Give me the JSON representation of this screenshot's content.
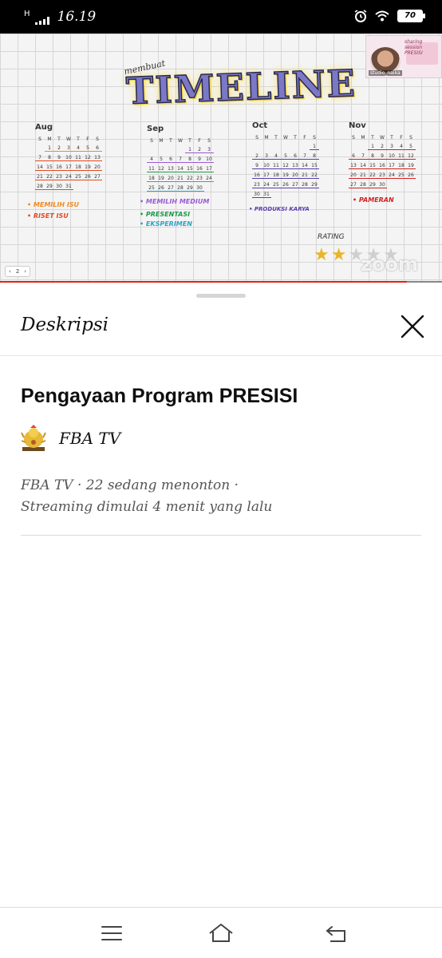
{
  "status_bar": {
    "network": "H",
    "time": "16.19",
    "battery": "70",
    "icons": [
      "alarm-icon",
      "wifi-icon",
      "battery-icon"
    ]
  },
  "video": {
    "whiteboard_subtitle": "membuat",
    "whiteboard_title": "TIMELINE",
    "calendars": [
      {
        "month": "Aug",
        "weekdays": [
          "S",
          "M",
          "T",
          "W",
          "T",
          "F",
          "S"
        ],
        "days": [
          "1",
          "2",
          "3",
          "4",
          "5",
          "6",
          "7",
          "8",
          "9",
          "10",
          "11",
          "12",
          "13",
          "14",
          "15",
          "16",
          "17",
          "18",
          "19",
          "20",
          "21",
          "22",
          "23",
          "24",
          "25",
          "26",
          "27",
          "28",
          "29",
          "30",
          "31"
        ]
      },
      {
        "month": "Sep",
        "weekdays": [
          "S",
          "M",
          "T",
          "W",
          "T",
          "F",
          "S"
        ],
        "days": [
          "1",
          "2",
          "3",
          "4",
          "5",
          "6",
          "7",
          "8",
          "9",
          "10",
          "11",
          "12",
          "13",
          "14",
          "15",
          "16",
          "17",
          "18",
          "19",
          "20",
          "21",
          "22",
          "23",
          "24",
          "25",
          "26",
          "27",
          "28",
          "29",
          "30"
        ]
      },
      {
        "month": "Oct",
        "weekdays": [
          "S",
          "M",
          "T",
          "W",
          "T",
          "F",
          "S"
        ],
        "days": [
          "1",
          "2",
          "3",
          "4",
          "5",
          "6",
          "7",
          "8",
          "9",
          "10",
          "11",
          "12",
          "13",
          "14",
          "15",
          "16",
          "17",
          "18",
          "19",
          "20",
          "21",
          "22",
          "23",
          "24",
          "25",
          "26",
          "27",
          "28",
          "29",
          "30",
          "31"
        ]
      },
      {
        "month": "Nov",
        "weekdays": [
          "S",
          "M",
          "T",
          "W",
          "T",
          "F",
          "S"
        ],
        "days": [
          "1",
          "2",
          "3",
          "4",
          "5",
          "6",
          "7",
          "8",
          "9",
          "10",
          "11",
          "12",
          "13",
          "14",
          "15",
          "16",
          "17",
          "18",
          "19",
          "20",
          "21",
          "22",
          "23",
          "24",
          "25",
          "26",
          "27",
          "28",
          "29",
          "30"
        ]
      }
    ],
    "notes": {
      "aug_1": "• MEMILIH ISU",
      "aug_2": "• RISET ISU",
      "sep_1": "• MEMILIH MEDIUM",
      "sep_2": "• PRESENTASI",
      "sep_3": "• EKSPERIMEN",
      "oct_1": "• PRODUKSI KARYA",
      "nov_1": "• PAMERAN"
    },
    "rating_label": "RATING",
    "rating_value": 2,
    "rating_max": 5,
    "watermark": "zoom",
    "participant": {
      "caption": "sharing session PRESISI",
      "name": "studio_naika"
    },
    "page_control": {
      "prev": "‹",
      "page": "2",
      "next": "›"
    },
    "progress": 0.92,
    "colors": {
      "progress": "#e62117",
      "title_fill": "#7b78c8",
      "highlight": "#f6dc5a"
    }
  },
  "sheet": {
    "title": "Deskripsi",
    "close_icon": "close-icon",
    "video_title": "Pengayaan Program PRESISI",
    "channel_name": "FBA TV",
    "meta_line1": "FBA TV · 22 sedang menonton ·",
    "meta_line2": "Streaming dimulai 4 menit yang lalu"
  },
  "nav": {
    "icons": [
      "menu-icon",
      "home-icon",
      "back-icon"
    ]
  }
}
